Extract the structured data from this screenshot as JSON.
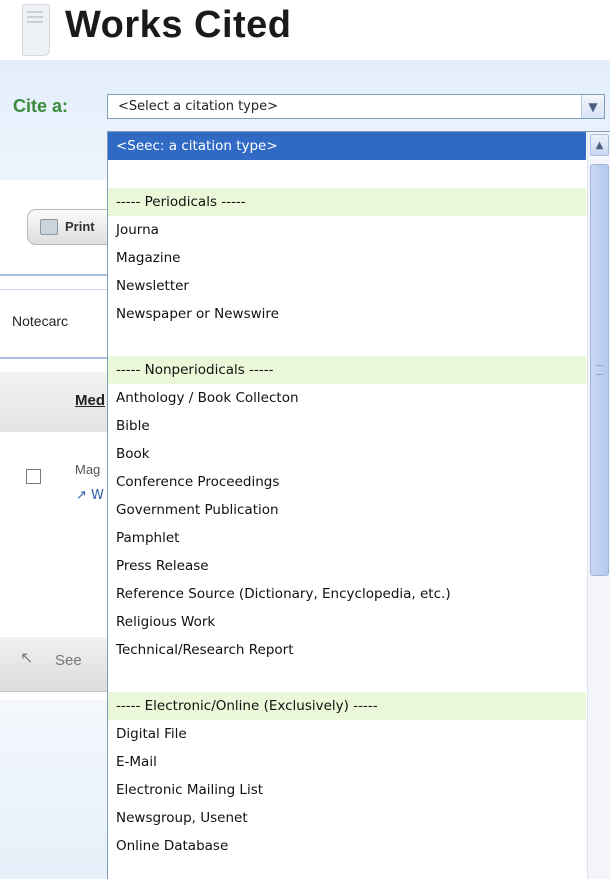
{
  "page": {
    "title": "Works Cited",
    "cite_label": "Cite a:",
    "select_value": "<Select a citation type>",
    "print_label": "Print",
    "notecards_label": "Notecarc",
    "header_med": "Med",
    "row_mag": "Mag",
    "row_link": "↗ W",
    "bottom_text": "See"
  },
  "icons": {
    "doc": "document-icon",
    "printer": "printer-icon",
    "dropdown_arrow": "chevron-down-icon",
    "scroll_up": "chevron-up-icon",
    "back": "back-icon"
  },
  "dropdown": {
    "options": [
      {
        "label": "<Seec: a citation type>",
        "kind": "selected"
      },
      {
        "label": "",
        "kind": "blank"
      },
      {
        "label": "----- Periodicals -----",
        "kind": "group"
      },
      {
        "label": "Journa",
        "kind": "option"
      },
      {
        "label": "Magazine",
        "kind": "option"
      },
      {
        "label": "Newsletter",
        "kind": "option"
      },
      {
        "label": "Newspaper or Newswire",
        "kind": "option"
      },
      {
        "label": "",
        "kind": "blank"
      },
      {
        "label": "----- Nonperiodicals -----",
        "kind": "group"
      },
      {
        "label": "Anthology / Book Collecton",
        "kind": "option"
      },
      {
        "label": "Bible",
        "kind": "option"
      },
      {
        "label": "Book",
        "kind": "option"
      },
      {
        "label": "Conference Proceedings",
        "kind": "option"
      },
      {
        "label": "Government Publication",
        "kind": "option"
      },
      {
        "label": "Pamphlet",
        "kind": "option"
      },
      {
        "label": "Press Release",
        "kind": "option"
      },
      {
        "label": "Reference Source (Dictionary, Encyclopedia, etc.)",
        "kind": "option"
      },
      {
        "label": "Religious Work",
        "kind": "option"
      },
      {
        "label": "Technical/Research Report",
        "kind": "option"
      },
      {
        "label": "",
        "kind": "blank"
      },
      {
        "label": "----- Electronic/Online (Exclusively) -----",
        "kind": "group"
      },
      {
        "label": "Digital File",
        "kind": "option"
      },
      {
        "label": "E-Mail",
        "kind": "option"
      },
      {
        "label": "Electronic Mailing List",
        "kind": "option"
      },
      {
        "label": "Newsgroup, Usenet",
        "kind": "option"
      },
      {
        "label": "Online Database",
        "kind": "option"
      }
    ]
  }
}
